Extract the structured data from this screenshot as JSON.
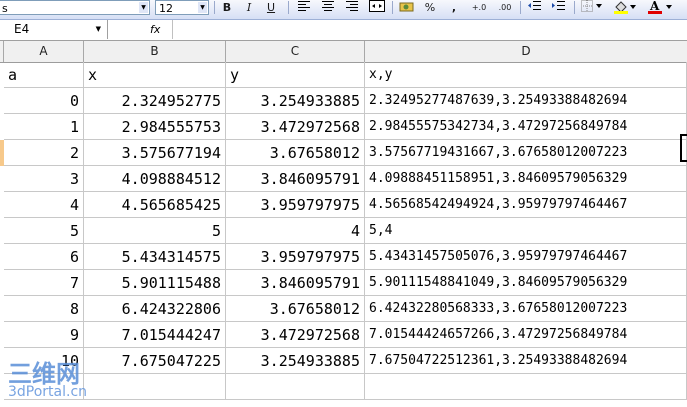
{
  "toolbar": {
    "font_name_partial": "s",
    "font_size": "12",
    "bold": "B",
    "italic": "I",
    "underline": "U",
    "percent": "%",
    "comma": ",",
    "increase_decimal": "+.0",
    "decrease_decimal": ".00"
  },
  "formula_bar": {
    "name_box": "E4",
    "fx": "fx",
    "value": ""
  },
  "columns": [
    "A",
    "B",
    "C",
    "D"
  ],
  "rows": [
    {
      "a": "a",
      "x": "x",
      "y": "y",
      "xy": "x,y"
    },
    {
      "a": "0",
      "x": "2.324952775",
      "y": "3.254933885",
      "xy": "2.32495277487639,3.25493388482694"
    },
    {
      "a": "1",
      "x": "2.984555753",
      "y": "3.472972568",
      "xy": "2.98455575342734,3.47297256849784"
    },
    {
      "a": "2",
      "x": "3.575677194",
      "y": "3.67658012",
      "xy": "3.57567719431667,3.67658012007223"
    },
    {
      "a": "3",
      "x": "4.098884512",
      "y": "3.846095791",
      "xy": "4.09888451158951,3.84609579056329"
    },
    {
      "a": "4",
      "x": "4.565685425",
      "y": "3.959797975",
      "xy": "4.56568542494924,3.95979797464467"
    },
    {
      "a": "5",
      "x": "5",
      "y": "4",
      "xy": "5,4"
    },
    {
      "a": "6",
      "x": "5.434314575",
      "y": "3.959797975",
      "xy": "5.43431457505076,3.95979797464467"
    },
    {
      "a": "7",
      "x": "5.901115488",
      "y": "3.846095791",
      "xy": "5.90111548841049,3.84609579056329"
    },
    {
      "a": "8",
      "x": "6.424322806",
      "y": "3.67658012",
      "xy": "6.42432280568333,3.67658012007223"
    },
    {
      "a": "9",
      "x": "7.015444247",
      "y": "3.472972568",
      "xy": "7.01544424657266,3.47297256849784"
    },
    {
      "a": "10",
      "x": "7.675047225",
      "y": "3.254933885",
      "xy": "7.67504722512361,3.25493388482694"
    }
  ],
  "watermark": {
    "line1": "三维网",
    "line2": "3dPortal.cn"
  }
}
